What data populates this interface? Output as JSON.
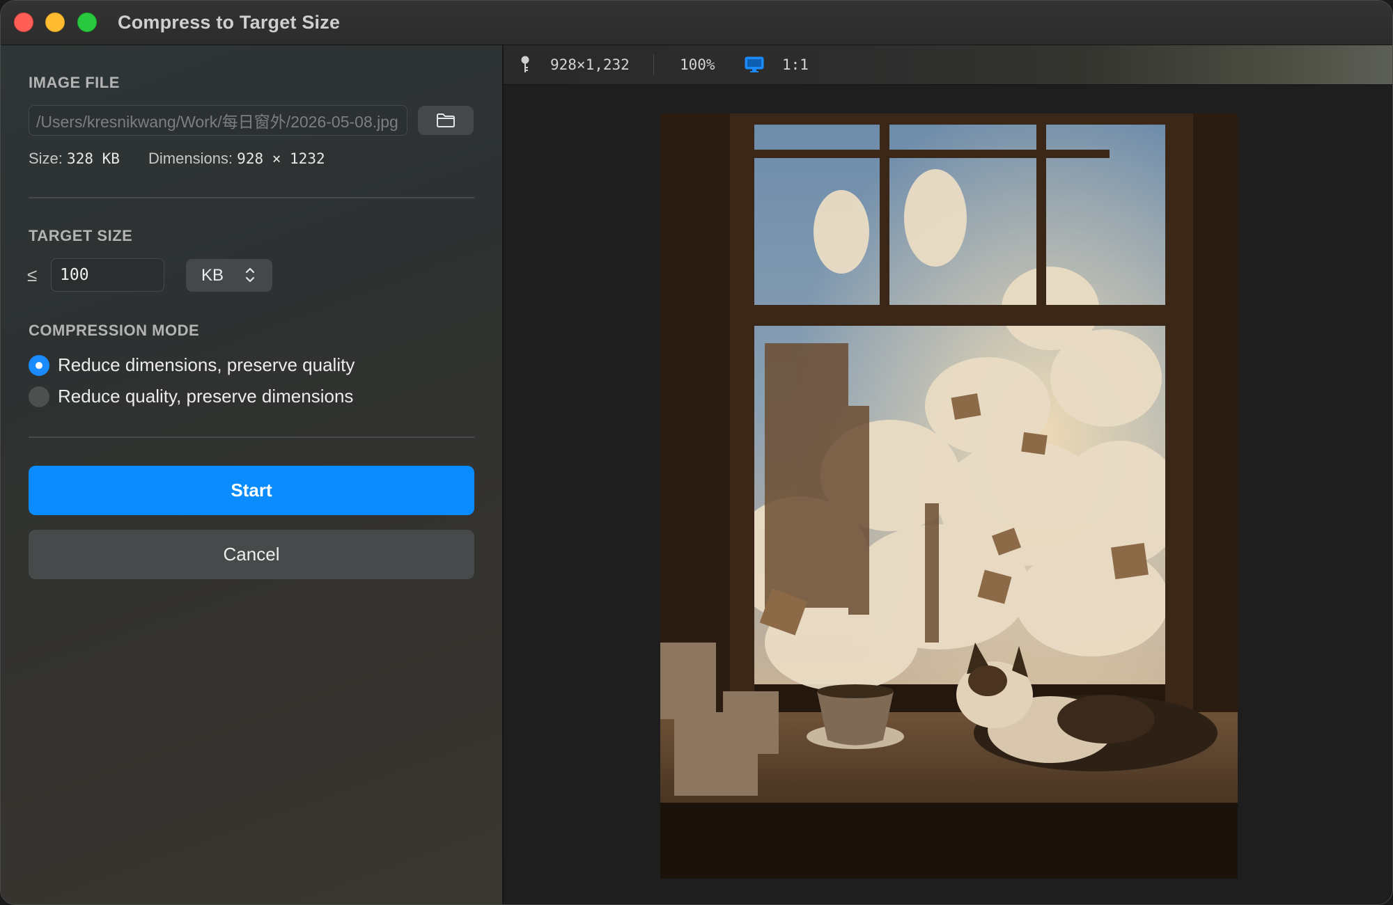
{
  "window": {
    "title": "Compress to Target Size",
    "controls": [
      "close",
      "minimize",
      "zoom"
    ]
  },
  "image_file": {
    "label": "IMAGE FILE",
    "path": "/Users/kresnikwang/Work/每日窗外/2026-05-08.jpg",
    "browse_icon": "folder-icon",
    "size_label": "Size:",
    "size_value": "328 KB",
    "dimensions_label": "Dimensions:",
    "dimensions_value": "928 × 1232"
  },
  "target_size": {
    "label": "TARGET SIZE",
    "operator": "≤",
    "value": "100",
    "unit": "KB"
  },
  "compression_mode": {
    "label": "COMPRESSION MODE",
    "options": [
      {
        "label": "Reduce dimensions, preserve quality",
        "selected": true
      },
      {
        "label": "Reduce quality, preserve dimensions",
        "selected": false
      }
    ]
  },
  "actions": {
    "start_label": "Start",
    "cancel_label": "Cancel"
  },
  "preview_toolbar": {
    "pin_icon": "pin-icon",
    "dimensions": "928×1,232",
    "zoom": "100%",
    "display_icon": "monitor-icon",
    "ratio": "1:1"
  },
  "preview": {
    "description_icon": "image-preview"
  },
  "colors": {
    "accent": "#0a8cff",
    "close": "#ff5f57",
    "minimize": "#febc2e",
    "zoom": "#28c840"
  }
}
